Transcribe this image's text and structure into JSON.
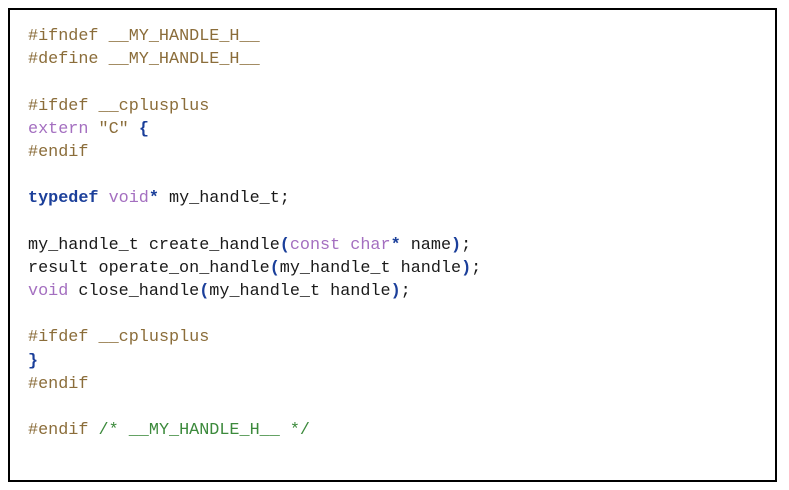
{
  "code": {
    "l1": {
      "directive": "#ifndef",
      "macro": "__MY_HANDLE_H__"
    },
    "l2": {
      "directive": "#define",
      "macro": "__MY_HANDLE_H__"
    },
    "l4": {
      "directive": "#ifdef",
      "macro": "__cplusplus"
    },
    "l5": {
      "keyword": "extern",
      "string": "\"C\"",
      "brace": "{"
    },
    "l6": {
      "directive": "#endif"
    },
    "l8": {
      "keyword": "typedef",
      "type": "void",
      "star": "*",
      "rest": " my_handle_t;"
    },
    "l10": {
      "a": "my_handle_t create_handle",
      "open": "(",
      "const": "const",
      "char": "char",
      "star": "*",
      "b": " name",
      "close": ")",
      "semi": ";"
    },
    "l11": {
      "a": "result operate_on_handle",
      "open": "(",
      "b": "my_handle_t handle",
      "close": ")",
      "semi": ";"
    },
    "l12": {
      "type": "void",
      "a": " close_handle",
      "open": "(",
      "b": "my_handle_t handle",
      "close": ")",
      "semi": ";"
    },
    "l14": {
      "directive": "#ifdef",
      "macro": "__cplusplus"
    },
    "l15": {
      "brace": "}"
    },
    "l16": {
      "directive": "#endif"
    },
    "l18": {
      "directive": "#endif",
      "comment": "/* __MY_HANDLE_H__ */"
    }
  }
}
